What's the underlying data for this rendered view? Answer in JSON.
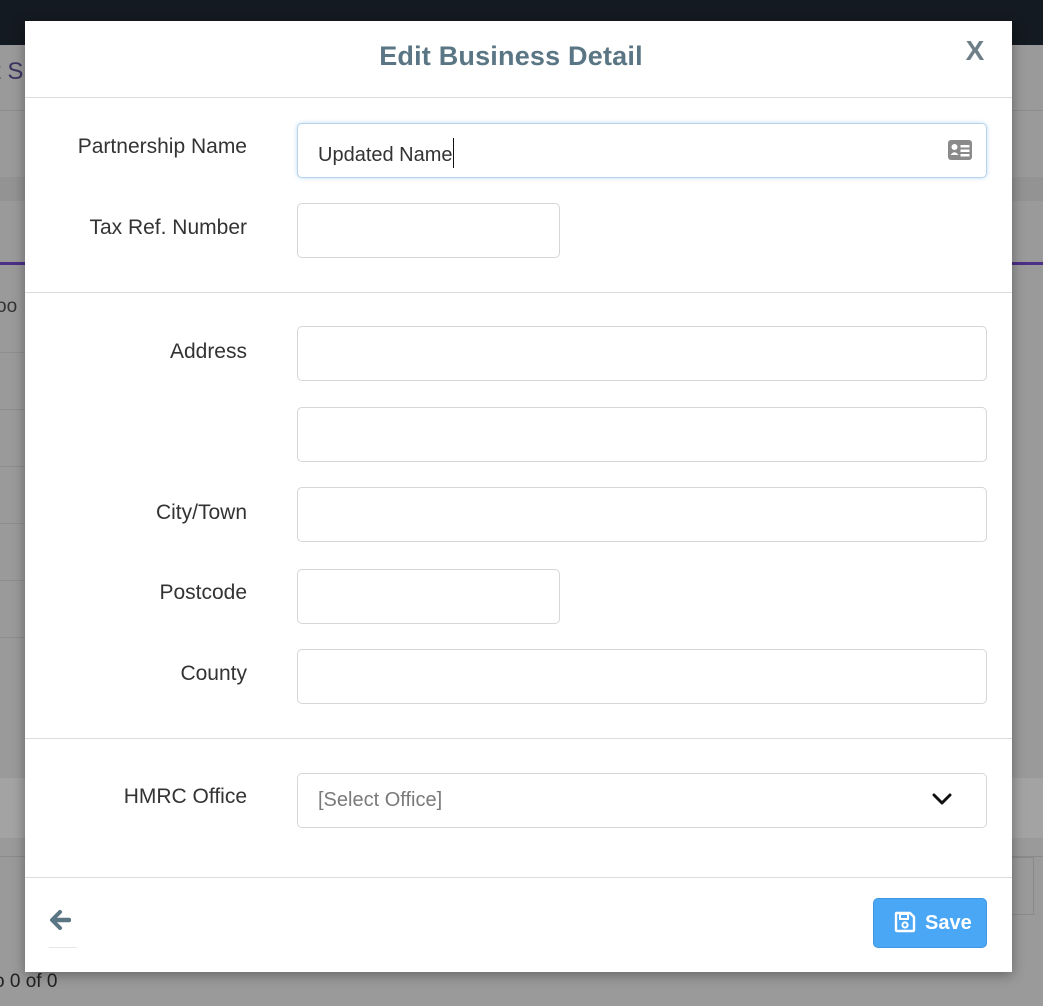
{
  "background": {
    "partial_title": "t S",
    "partial_text": "oo",
    "footer_text": "o 0 of 0"
  },
  "modal": {
    "title": "Edit Business Detail",
    "close_label": "X",
    "fields": {
      "partnership_name": {
        "label": "Partnership Name",
        "value": "Updated Name",
        "icon": "contact-card-icon"
      },
      "tax_ref": {
        "label": "Tax Ref. Number",
        "value": ""
      },
      "address": {
        "label": "Address",
        "line1": "",
        "line2": ""
      },
      "city": {
        "label": "City/Town",
        "value": ""
      },
      "postcode": {
        "label": "Postcode",
        "value": ""
      },
      "county": {
        "label": "County",
        "value": ""
      },
      "hmrc_office": {
        "label": "HMRC Office",
        "selected": "[Select Office]",
        "icon": "chevron-down-icon"
      }
    },
    "footer": {
      "back_icon": "arrow-left-icon",
      "save_label": "Save",
      "save_icon": "floppy-disk-icon"
    }
  },
  "colors": {
    "title": "#5a7684",
    "save_button": "#4aa7f6",
    "focus_border": "#b8d3ec"
  }
}
